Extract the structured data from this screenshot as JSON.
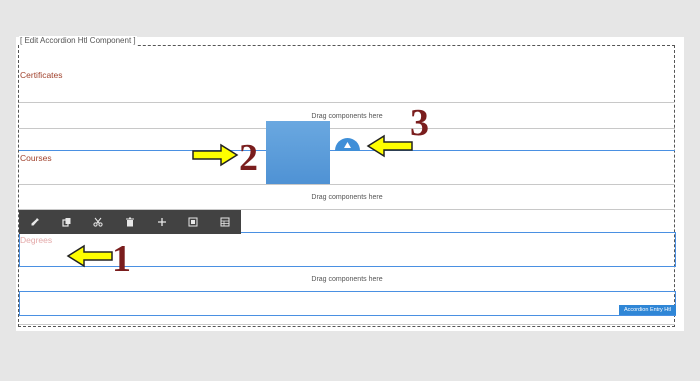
{
  "editor": {
    "component_caption": "[ Edit Accordion Htl Component ]",
    "drag_placeholder": "Drag components here",
    "selected_label": "Accordion Entry Htl"
  },
  "accordion": {
    "items": [
      {
        "heading": "Certificates"
      },
      {
        "heading": "Courses"
      },
      {
        "heading": "Degrees"
      }
    ]
  },
  "toolbar": {
    "buttons": [
      {
        "icon": "wrench-icon"
      },
      {
        "icon": "copy-icon"
      },
      {
        "icon": "cut-icon"
      },
      {
        "icon": "trash-icon"
      },
      {
        "icon": "plus-icon"
      },
      {
        "icon": "group-icon"
      },
      {
        "icon": "layout-icon"
      }
    ]
  },
  "annotations": {
    "callout_1": "1",
    "callout_2": "2",
    "callout_3": "3",
    "arrow_color": "#ffff00",
    "number_color": "#7a1d1d"
  },
  "colors": {
    "selection_blue": "#4a90e2",
    "heading_red": "#a0412c",
    "toolbar_bg": "#424242"
  }
}
